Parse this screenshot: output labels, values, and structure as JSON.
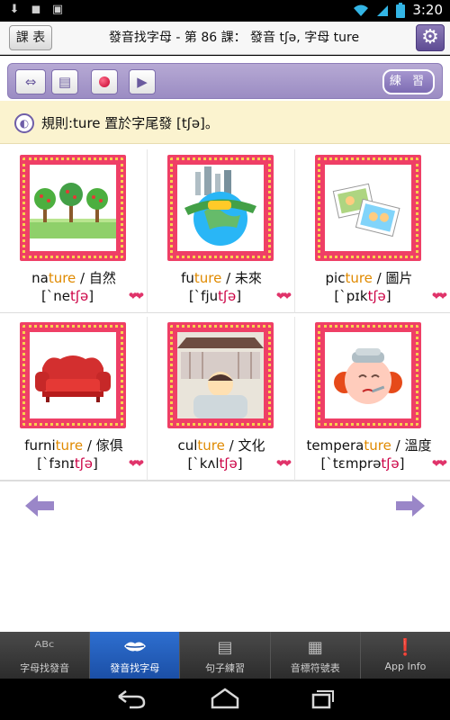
{
  "status_bar": {
    "time": "3:20"
  },
  "title_bar": {
    "lesson_button": "課 表",
    "title": "發音找字母 - 第 86 課： 發音 tʃə, 字母 ture"
  },
  "toolbar": {
    "practice_label": "練 習"
  },
  "rule": {
    "text": "規則:ture 置於字尾發 [tʃə]。"
  },
  "words": [
    {
      "pre": "na",
      "hl": "ture",
      "post": " / 自然",
      "ph_pre": "[`ne",
      "ph_hl": "tʃə",
      "ph_post": "]"
    },
    {
      "pre": "fu",
      "hl": "ture",
      "post": " / 未來",
      "ph_pre": "[`fju",
      "ph_hl": "tʃə",
      "ph_post": "]"
    },
    {
      "pre": "pic",
      "hl": "ture",
      "post": " / 圖片",
      "ph_pre": "[`pɪk",
      "ph_hl": "tʃə",
      "ph_post": "]"
    },
    {
      "pre": "furni",
      "hl": "ture",
      "post": " / 傢俱",
      "ph_pre": "[`fɜnɪ",
      "ph_hl": "tʃə",
      "ph_post": "]"
    },
    {
      "pre": "cul",
      "hl": "ture",
      "post": " / 文化",
      "ph_pre": "[`kʌl",
      "ph_hl": "tʃə",
      "ph_post": "]"
    },
    {
      "pre": "tempera",
      "hl": "ture",
      "post": " / 溫度",
      "ph_pre": "[`tɛmprə",
      "ph_hl": "tʃə",
      "ph_post": "]"
    }
  ],
  "tabs": [
    {
      "label": "字母找發音",
      "icon": "abc-icon"
    },
    {
      "label": "發音找字母",
      "icon": "lips-icon"
    },
    {
      "label": "句子練習",
      "icon": "document-icon"
    },
    {
      "label": "音標符號表",
      "icon": "chart-icon"
    },
    {
      "label": "App Info",
      "icon": "info-icon"
    }
  ],
  "colors": {
    "accent_purple": "#9b8cc3",
    "card_frame": "#ef3f66",
    "highlight": "#e08a00",
    "tab_active": "#1b4fa6"
  }
}
